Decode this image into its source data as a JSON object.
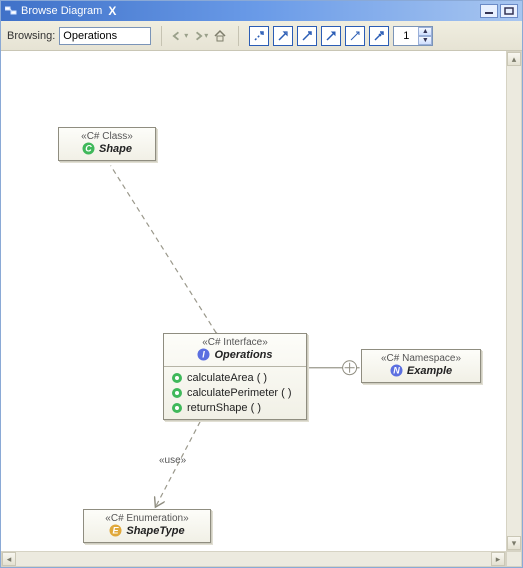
{
  "titlebar": {
    "title": "Browse Diagram",
    "close_label": "X"
  },
  "toolbar": {
    "browsing_label": "Browsing:",
    "browsing_value": "Operations",
    "depth_value": "1"
  },
  "icons": {
    "back": "back-arrow",
    "forward": "forward-arrow",
    "home": "home",
    "tool1": "arrow-ne-dashed",
    "tool2": "arrow-ne-solid",
    "tool3": "arrow-ne-open",
    "tool4": "arrow-ne-filled",
    "tool5": "arrow-ne-thin",
    "tool6": "arrow-ne-cross"
  },
  "nodes": {
    "shape": {
      "stereotype": "«C# Class»",
      "name": "Shape",
      "icon": "C"
    },
    "operations": {
      "stereotype": "«C# Interface»",
      "name": "Operations",
      "icon": "I",
      "methods": {
        "m0": "calculateArea ( )",
        "m1": "calculatePerimeter ( )",
        "m2": "returnShape ( )"
      }
    },
    "namespace": {
      "stereotype": "«C# Namespace»",
      "name": "Example",
      "icon": "N"
    },
    "enum": {
      "stereotype": "«C# Enumeration»",
      "name": "ShapeType",
      "icon": "E"
    }
  },
  "edges": {
    "use_label": "«use»"
  },
  "colors": {
    "class_icon_bg": "#3fb85a",
    "interface_icon_bg": "#5b6fe0",
    "namespace_icon_bg": "#5b6fe0",
    "enum_icon_bg": "#e0a83a",
    "method_icon_bg": "#3fb85a"
  }
}
